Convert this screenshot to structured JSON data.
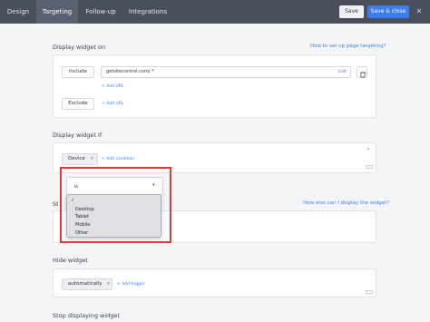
{
  "topbar": {
    "tabs": [
      {
        "label": "Design"
      },
      {
        "label": "Targeting"
      },
      {
        "label": "Follow-up"
      },
      {
        "label": "Integrations"
      }
    ],
    "save_label": "Save",
    "save_close_label": "Save & close"
  },
  "display_on": {
    "title": "Display widget on",
    "help_link": "How to set up page targeting?",
    "include_label": "Include",
    "include_url": "getsitecontrol.com/ *",
    "edit_label": "Edit",
    "add_url_label": "+ Add URL",
    "exclude_label": "Exclude",
    "exclude_add_url_label": "+ Add URL"
  },
  "display_if": {
    "title": "Display widget if",
    "device_pill": "Device",
    "add_condition_label": "+ Add condition",
    "operator_value": "is",
    "device_options": [
      "Desktop",
      "Tablet",
      "Mobile",
      "Other"
    ],
    "selected_indicator": "✓"
  },
  "start_section": {
    "title_partial": "St",
    "help_link": "How else can I display the widget?"
  },
  "hide_widget": {
    "title": "Hide widget",
    "trigger_pill": "automatically",
    "add_trigger_label": "+ Add trigger"
  },
  "stop_section": {
    "title": "Stop displaying widget"
  }
}
